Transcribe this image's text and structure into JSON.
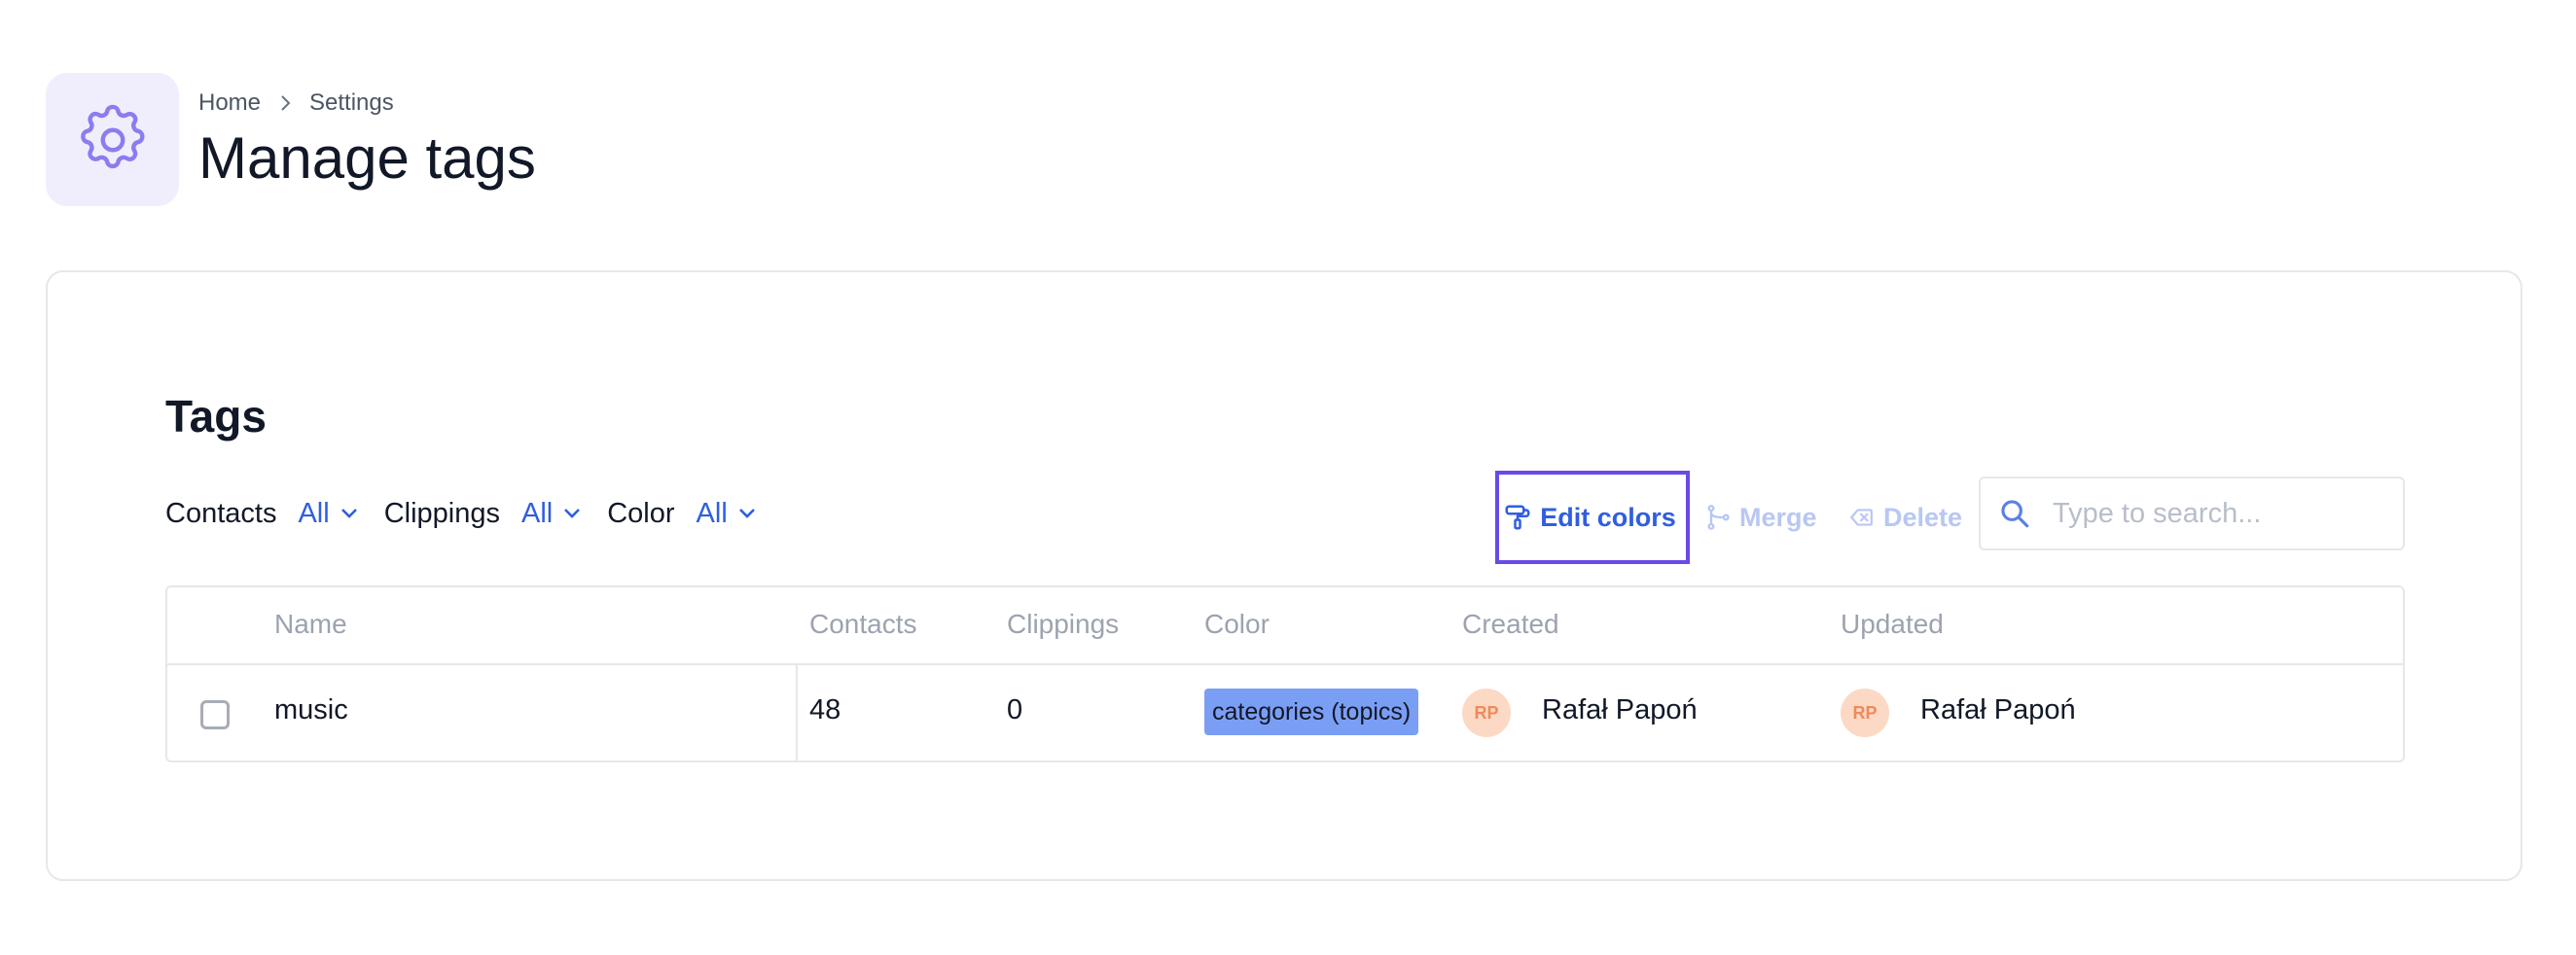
{
  "header": {
    "breadcrumb": [
      "Home",
      "Settings"
    ],
    "title": "Manage tags",
    "icon": "gear-icon"
  },
  "tags_section": {
    "title": "Tags",
    "filters": [
      {
        "label": "Contacts",
        "value": "All"
      },
      {
        "label": "Clippings",
        "value": "All"
      },
      {
        "label": "Color",
        "value": "All"
      }
    ],
    "toolbar": {
      "edit_colors": "Edit colors",
      "merge": "Merge",
      "delete": "Delete"
    },
    "search": {
      "placeholder": "Type to search...",
      "value": ""
    }
  },
  "table": {
    "columns": [
      "Name",
      "Contacts",
      "Clippings",
      "Color",
      "Created",
      "Updated"
    ],
    "rows": [
      {
        "name": "music",
        "contacts": "48",
        "clippings": "0",
        "color": "categories (topics)",
        "created": {
          "initials": "RP",
          "name": "Rafał Papoń"
        },
        "updated": {
          "initials": "RP",
          "name": "Rafał Papoń"
        }
      }
    ]
  },
  "colors": {
    "accent": "#2f5ee0",
    "focus_border": "#6a4ae6",
    "disabled": "#b8c7f3",
    "badge_bg": "#7b9ef5",
    "avatar_bg": "#fcd9c4",
    "avatar_text": "#ee8a5b",
    "icon_box_bg": "#f0eefd"
  }
}
